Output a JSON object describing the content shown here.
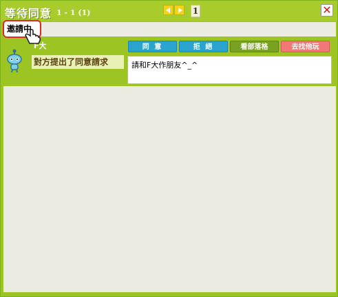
{
  "window": {
    "title": "等待同意",
    "page_count": "1 - 1 (1)",
    "page_number": "1"
  },
  "tab": {
    "label": "邀請中"
  },
  "request": {
    "username": "F大",
    "status_label": "對方提出了同意請求",
    "message": "請和F大作朋友^_^",
    "buttons": {
      "agree": "同 意",
      "reject": "拒 絕",
      "view_blog": "看部落格",
      "play_elsewhere": "去找他玩"
    }
  },
  "colors": {
    "frame": "#9cc422",
    "content_bg": "#ecebe1",
    "blue_button": "#2aa3cf",
    "green_button": "#7aa221",
    "red_button": "#f27878",
    "tab_border": "#e22525"
  },
  "icons": [
    "prev-arrow-icon",
    "next-arrow-icon",
    "close-icon",
    "hand-pointer-icon",
    "avatar-icon"
  ]
}
